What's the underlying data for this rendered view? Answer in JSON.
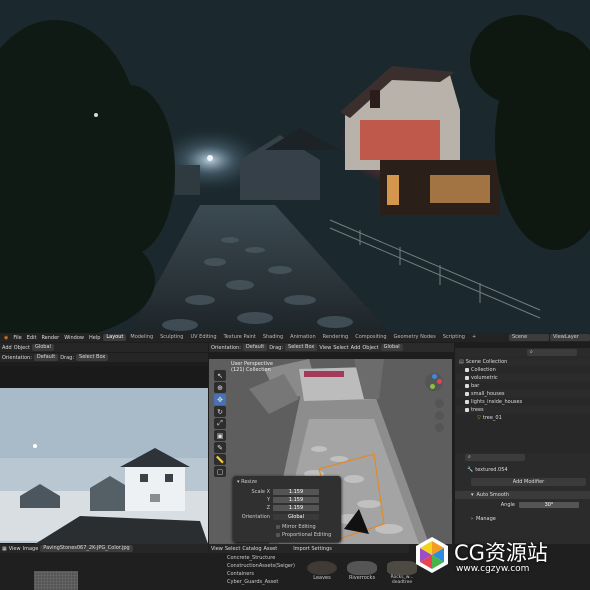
{
  "topbar": {
    "menus": [
      "File",
      "Edit",
      "Render",
      "Window",
      "Help"
    ],
    "tabs": [
      "Layout",
      "Modeling",
      "Sculpting",
      "UV Editing",
      "Texture Paint",
      "Shading",
      "Animation",
      "Rendering",
      "Compositing",
      "Geometry Nodes",
      "Scripting"
    ],
    "plus": "+",
    "scene": "Scene",
    "view_layer": "ViewLayer"
  },
  "left_header": {
    "items": [
      "Add",
      "Object"
    ],
    "orientation_label": "Orientation:",
    "orientation_value": "Default",
    "transform": "Global",
    "drag_label": "Drag:",
    "drag_value": "Select Box"
  },
  "main_header": {
    "orientation_label": "Orientation:",
    "orientation_value": "Default",
    "drag_label": "Drag:",
    "drag_value": "Select Box",
    "items": [
      "View",
      "Select",
      "Add",
      "Object"
    ],
    "transform": "Global"
  },
  "viewport": {
    "title": "User Perspective",
    "subtitle": "(121) Collection"
  },
  "resize_panel": {
    "title": "Resize",
    "fields": [
      {
        "label": "Scale X",
        "value": "1.159"
      },
      {
        "label": "Y",
        "value": "1.159"
      },
      {
        "label": "Z",
        "value": "1.159"
      }
    ],
    "orientation_label": "Orientation",
    "orientation_value": "Global",
    "options": [
      "Mirror Editing",
      "Proportional Editing"
    ]
  },
  "outliner": {
    "header": "Scene Collection",
    "items": [
      "Collection",
      "volumetric",
      "bar",
      "small_houses",
      "lights_inside_houses",
      "trees"
    ],
    "sub": "tree_01"
  },
  "properties": {
    "object": "textured.054",
    "add_modifier": "Add Modifier",
    "modifier": "Auto Smooth",
    "angle_label": "Angle",
    "angle_value": "30°",
    "merge": "Manage"
  },
  "image_editor": {
    "items": [
      "View",
      "Image"
    ],
    "file": "PavingStones067_2K-JPG_Color.jpg"
  },
  "asset_browser": {
    "menu": [
      "View",
      "Select",
      "Catalog",
      "Asset"
    ],
    "import_label": "Import Settings",
    "catalogs": [
      "Concrete_Structure",
      "ConstructionAssets(Seiger)",
      "Containers",
      "Cyber_Guards_Asset"
    ],
    "assets": [
      "Leaves",
      "Riverrocks",
      "Rocks_w... deadtree"
    ]
  },
  "watermark": {
    "brand": "CG资源站",
    "url": "www.cgzyw.com"
  },
  "colors": {
    "accent": "#4772b3",
    "orange": "#e08a2a",
    "logo_orange": "#f39c1f",
    "logo_blue": "#2d8be0",
    "logo_green": "#47b549"
  }
}
